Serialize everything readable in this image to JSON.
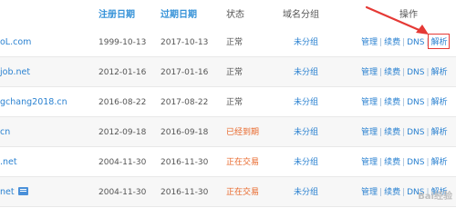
{
  "header": {
    "reg_date": "注册日期",
    "exp_date": "过期日期",
    "status": "状态",
    "group": "域名分组",
    "actions": "操作"
  },
  "rows": [
    {
      "domain": "oL.com",
      "reg": "1999-10-13",
      "exp": "2017-10-13",
      "status": "正常",
      "status_color": "#555555",
      "group": "未分组"
    },
    {
      "domain": "job.net",
      "reg": "2012-01-16",
      "exp": "2017-01-16",
      "status": "正常",
      "status_color": "#555555",
      "group": "未分组"
    },
    {
      "domain": "gchang2018.cn",
      "reg": "2016-08-22",
      "exp": "2017-08-22",
      "status": "正常",
      "status_color": "#555555",
      "group": "未分组"
    },
    {
      "domain": "cn",
      "reg": "2012-09-18",
      "exp": "2016-09-18",
      "status": "已经到期",
      "status_color": "#e8672a",
      "group": "未分组"
    },
    {
      "domain": ".net",
      "reg": "2004-11-30",
      "exp": "2016-11-30",
      "status": "正在交易",
      "status_color": "#e8672a",
      "group": "未分组"
    },
    {
      "domain": "net",
      "reg": "2004-11-30",
      "exp": "2016-11-30",
      "status": "正在交易",
      "status_color": "#e8672a",
      "group": "未分组"
    }
  ],
  "ops": {
    "manage": "管理",
    "renew": "续费",
    "dns": "DNS",
    "resolve": "解析"
  },
  "colors": {
    "link": "#2b82d1",
    "header_sort": "#3592d8",
    "warning": "#e8672a",
    "highlight": "#e53935"
  },
  "watermark": "Bai经验"
}
